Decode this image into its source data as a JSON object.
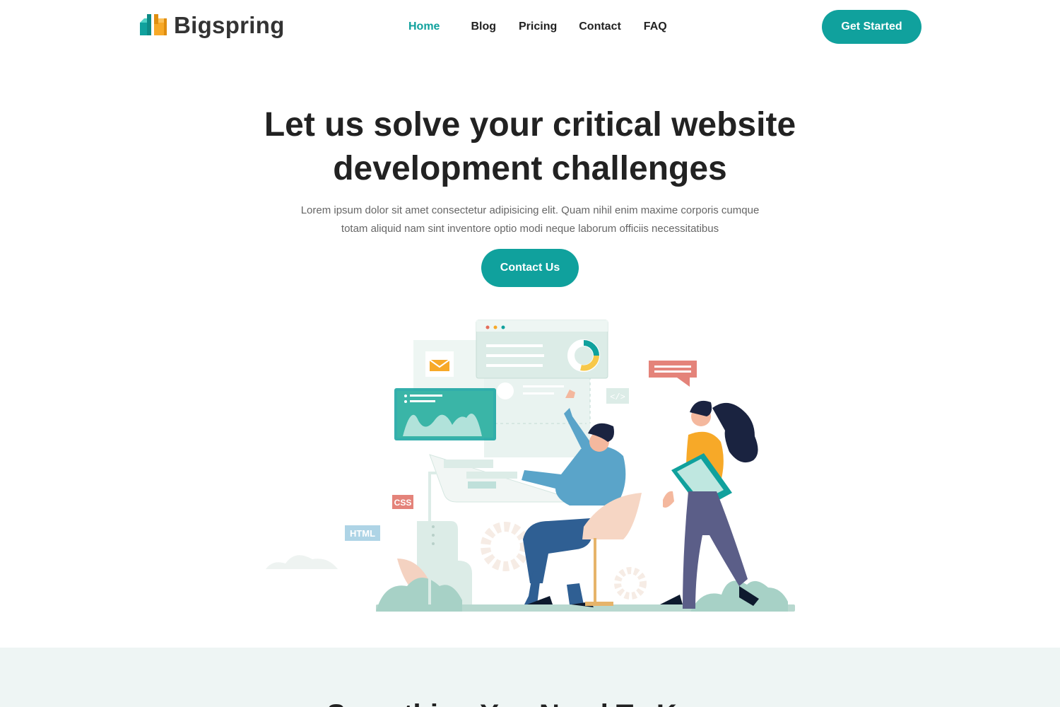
{
  "brand": {
    "name": "Bigspring",
    "logo_icon": "bigspring-logo-icon"
  },
  "nav": {
    "items": [
      {
        "label": "Home",
        "active": true
      },
      {
        "label": "Blog",
        "active": false
      },
      {
        "label": "Pricing",
        "active": false
      },
      {
        "label": "Contact",
        "active": false
      },
      {
        "label": "FAQ",
        "active": false
      }
    ],
    "cta_label": "Get Started"
  },
  "hero": {
    "title_line1": "Let us solve your critical website",
    "title_line2": "development challenges",
    "description_line1": "Lorem ipsum dolor sit amet consectetur adipisicing elit. Quam nihil enim maxime corporis cumque",
    "description_line2": "totam aliquid nam sint inventore optio modi neque laborum officiis necessitatibus",
    "cta_label": "Contact Us",
    "illustration": {
      "css_tag": "CSS",
      "html_tag": "HTML",
      "code_tag": "</>"
    }
  },
  "section2": {
    "title": "Something You Need To Know"
  },
  "colors": {
    "accent": "#10a19d",
    "text_dark": "#222222",
    "text_muted": "#666666",
    "band_bg": "#eef5f4"
  }
}
